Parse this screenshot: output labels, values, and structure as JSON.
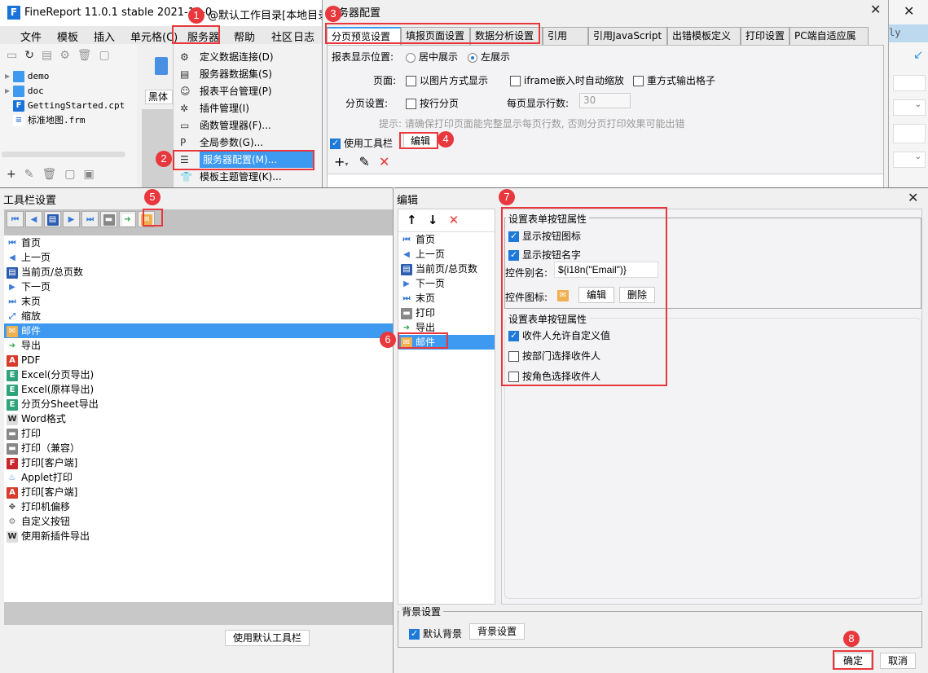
{
  "app": {
    "title": "FineReport 11.0.1 stable 2021-12-0",
    "title_suffix": "@默认工作目录[本地目录]",
    "menu": [
      "文件",
      "模板",
      "插入",
      "单元格(C)",
      "服务器",
      "帮助",
      "社区",
      "日志"
    ],
    "file_tree": [
      {
        "label": "demo",
        "icon": "folder"
      },
      {
        "label": "doc",
        "icon": "folder"
      },
      {
        "label": "GettingStarted.cpt",
        "icon": "cpt"
      },
      {
        "label": "标准地图.frm",
        "icon": "frm"
      }
    ],
    "font_field": "黑体",
    "right_partial_text": "ly"
  },
  "server_menu": {
    "items": [
      {
        "label": "定义数据连接(D)"
      },
      {
        "label": "服务器数据集(S)"
      },
      {
        "label": "报表平台管理(P)"
      },
      {
        "label": "插件管理(I)"
      },
      {
        "label": "函数管理器(F)..."
      },
      {
        "label": "全局参数(G)..."
      },
      {
        "label": "服务器配置(M)..."
      },
      {
        "label": "模板主题管理(K)..."
      }
    ]
  },
  "server_dialog": {
    "title": "服务器配置",
    "tabs": [
      "分页预览设置",
      "填报页面设置",
      "数据分析设置",
      "引用Css",
      "引用JavaScript",
      "出错模板定义",
      "打印设置",
      "PC端自适应属性"
    ],
    "position_label": "报表显示位置:",
    "position_options": [
      "居中展示",
      "左展示"
    ],
    "page_label": "页面:",
    "page_options": [
      "以图片方式显示",
      "iframe嵌入时自动缩放",
      "重方式输出格子"
    ],
    "paging_label": "分页设置:",
    "paging_option": "按行分页",
    "rows_label": "每页显示行数:",
    "rows_value": "30",
    "hint": "提示: 请确保打印页面能完整显示每页行数, 否则分页打印效果可能出错",
    "use_toolbar_label": "使用工具栏",
    "edit_label": "编辑"
  },
  "toolbar_dialog": {
    "title": "工具栏设置",
    "strip_icons": [
      "first",
      "prev",
      "pageinfo",
      "next",
      "last",
      "print",
      "export",
      "mail"
    ],
    "items": [
      {
        "label": "首页",
        "icon": "first"
      },
      {
        "label": "上一页",
        "icon": "prev"
      },
      {
        "label": "当前页/总页数",
        "icon": "pageinfo"
      },
      {
        "label": "下一页",
        "icon": "next"
      },
      {
        "label": "末页",
        "icon": "last"
      },
      {
        "label": "缩放",
        "icon": "zoom"
      },
      {
        "label": "邮件",
        "icon": "mail"
      },
      {
        "label": "导出",
        "icon": "export"
      },
      {
        "label": "PDF",
        "icon": "pdf"
      },
      {
        "label": "Excel(分页导出)",
        "icon": "excel"
      },
      {
        "label": "Excel(原样导出)",
        "icon": "excel"
      },
      {
        "label": "分页分Sheet导出",
        "icon": "excel"
      },
      {
        "label": "Word格式",
        "icon": "word"
      },
      {
        "label": "打印",
        "icon": "print"
      },
      {
        "label": "打印（兼容）",
        "icon": "print"
      },
      {
        "label": "打印[客户端]",
        "icon": "flash"
      },
      {
        "label": "Applet打印",
        "icon": "applet"
      },
      {
        "label": "打印[客户端]",
        "icon": "pdf"
      },
      {
        "label": "打印机偏移",
        "icon": "move"
      },
      {
        "label": "自定义按钮",
        "icon": "gear"
      },
      {
        "label": "使用新插件导出",
        "icon": "word"
      }
    ],
    "selected_index": 6,
    "default_button": "使用默认工具栏"
  },
  "edit_dialog": {
    "title": "编辑",
    "list": [
      {
        "label": "首页",
        "icon": "first"
      },
      {
        "label": "上一页",
        "icon": "prev"
      },
      {
        "label": "当前页/总页数",
        "icon": "pageinfo"
      },
      {
        "label": "下一页",
        "icon": "next"
      },
      {
        "label": "末页",
        "icon": "last"
      },
      {
        "label": "打印",
        "icon": "print"
      },
      {
        "label": "导出",
        "icon": "export"
      },
      {
        "label": "邮件",
        "icon": "mail"
      }
    ],
    "selected_index": 7,
    "group1_title": "设置表单按钮属性",
    "show_icon": "显示按钮图标",
    "show_name": "显示按钮名字",
    "alias_label": "控件别名:",
    "alias_value": "${i18n(\"Email\")}",
    "icon_label": "控件图标:",
    "icon_edit": "编辑",
    "icon_delete": "删除",
    "group2_title": "设置表单按钮属性",
    "recipient_options": [
      {
        "label": "收件人允许自定义值",
        "checked": true
      },
      {
        "label": "按部门选择收件人",
        "checked": false
      },
      {
        "label": "按角色选择收件人",
        "checked": false
      }
    ],
    "bg_title": "背景设置",
    "default_bg": "默认背景",
    "bg_settings": "背景设置",
    "ok": "确定",
    "cancel": "取消"
  },
  "badges": [
    "1",
    "2",
    "3",
    "4",
    "5",
    "6",
    "7",
    "8"
  ],
  "colors": {
    "accent": "#3d9af0",
    "annotation": "#e8383d",
    "mail": "#f0b050"
  }
}
